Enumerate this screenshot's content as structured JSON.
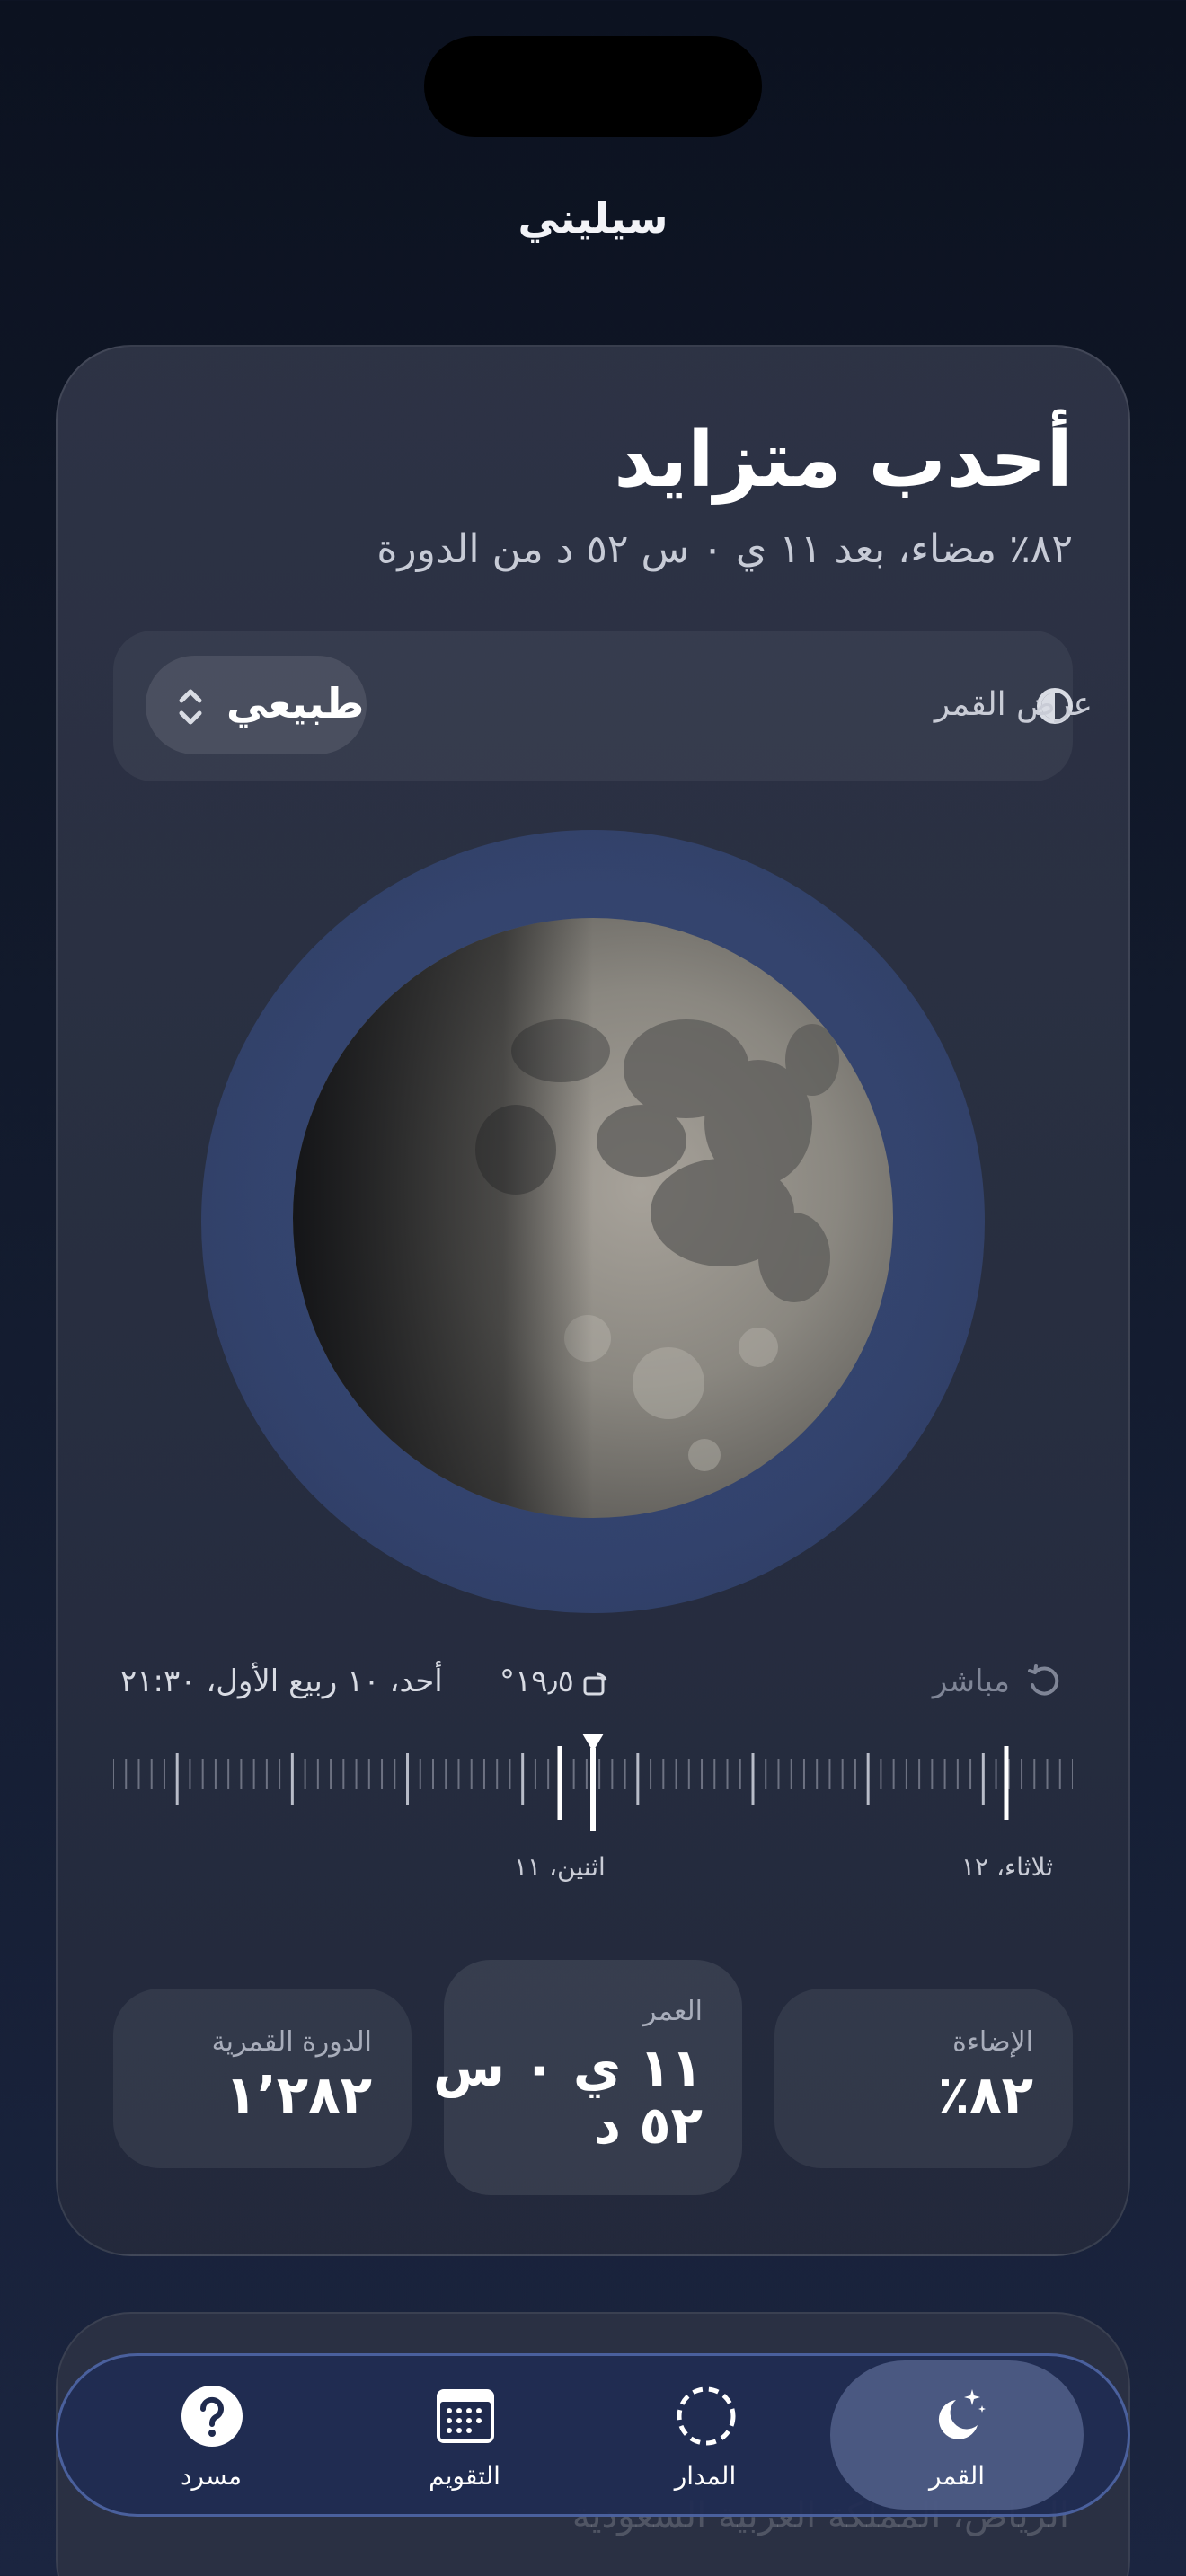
{
  "app": {
    "title": "سيليني"
  },
  "phase": {
    "name": "أحدب متزايد",
    "subtitle": "٨٢٪ مضاء، بعد ١١ ي ٠ س ٥٢ د من الدورة"
  },
  "view_mode": {
    "label": "عرض القمر",
    "icon": "half-circle-icon",
    "selected": "طبيعي"
  },
  "moon": {
    "illumination_fraction": 0.82
  },
  "scrubber": {
    "live_label": "مباشر",
    "tilt": "١٩٫٥°",
    "datetime": "أحد، ١٠ ربيع الأول، ٢١:٣٠",
    "day_labels": [
      "ثلاثاء، ١٢",
      "اثنين، ١١"
    ]
  },
  "stats": {
    "illumination": {
      "label": "الإضاءة",
      "value": "٨٢٪"
    },
    "age": {
      "label": "العمر",
      "value_line1": "١١ ي ٠ س",
      "value_line2": "٥٢ د"
    },
    "lunation": {
      "label": "الدورة القمرية",
      "value": "١٬٢٨٢"
    }
  },
  "background_card": {
    "text": "الرياض، المملكة العربية السعودية"
  },
  "tabbar": {
    "tabs": [
      {
        "label": "القمر",
        "icon": "moon-stars-icon",
        "active": true
      },
      {
        "label": "المدار",
        "icon": "orbit-dashed-circle-icon",
        "active": false
      },
      {
        "label": "التقويم",
        "icon": "calendar-icon",
        "active": false
      },
      {
        "label": "مسرد",
        "icon": "question-mark-icon",
        "active": false
      }
    ]
  },
  "colors": {
    "background": "#0c1220",
    "card": "#2c3244",
    "halo": "#3c5492",
    "accent_border": "#6e8cdc"
  }
}
